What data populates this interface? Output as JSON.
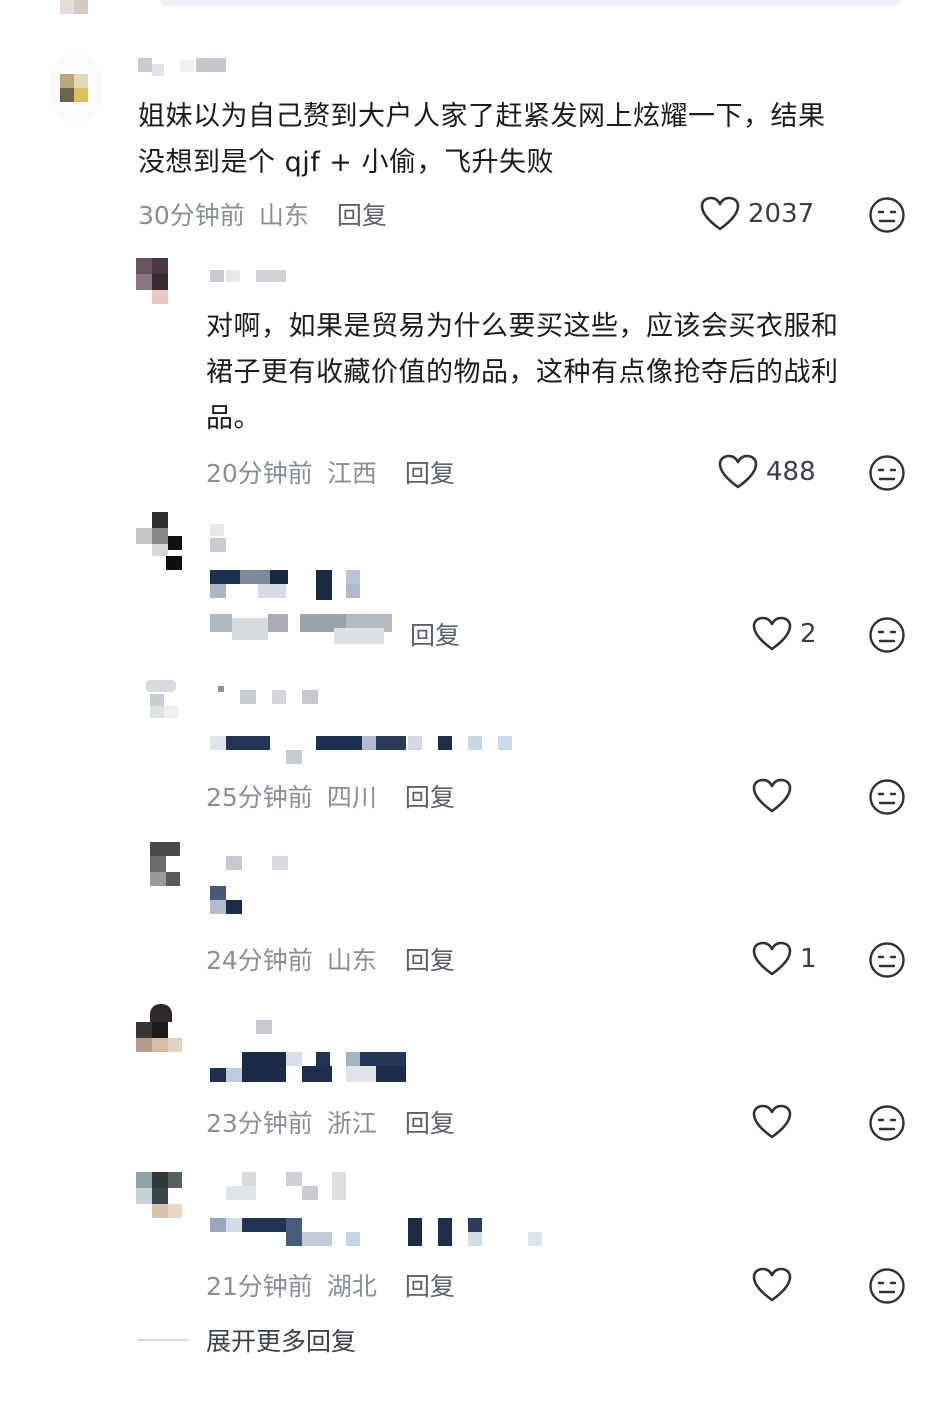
{
  "comment_main": {
    "text": "姐妹以为自己赘到大户人家了赶紧发网上炫耀一下，结果\n没想到是个 qjf + 小偷，飞升失败",
    "time": "30分钟前",
    "location": "山东",
    "reply_label": "回复",
    "likes": "2037"
  },
  "replies": [
    {
      "text": "对啊，如果是贸易为什么要买这些，应该会买衣服和\n裙子更有收藏价值的物品，这种有点像抢夺后的战利\n品。",
      "time": "20分钟前",
      "location": "江西",
      "reply_label": "回复",
      "likes": "488"
    },
    {
      "reply_label": "回复",
      "likes": "2"
    },
    {
      "time": "25分钟前",
      "location": "四川",
      "reply_label": "回复",
      "likes": ""
    },
    {
      "time": "24分钟前",
      "location": "山东",
      "reply_label": "回复",
      "likes": "1"
    },
    {
      "time": "23分钟前",
      "location": "浙江",
      "reply_label": "回复",
      "likes": ""
    },
    {
      "time": "21分钟前",
      "location": "湖北",
      "reply_label": "回复",
      "likes": ""
    }
  ],
  "expand_more_label": "展开更多回复",
  "icons": {
    "like": "heart-outline-icon",
    "dislike": "neutral-face-icon"
  },
  "colors": {
    "meta_text": "#8a8f96",
    "mosaic_dark": "#1e3050"
  }
}
